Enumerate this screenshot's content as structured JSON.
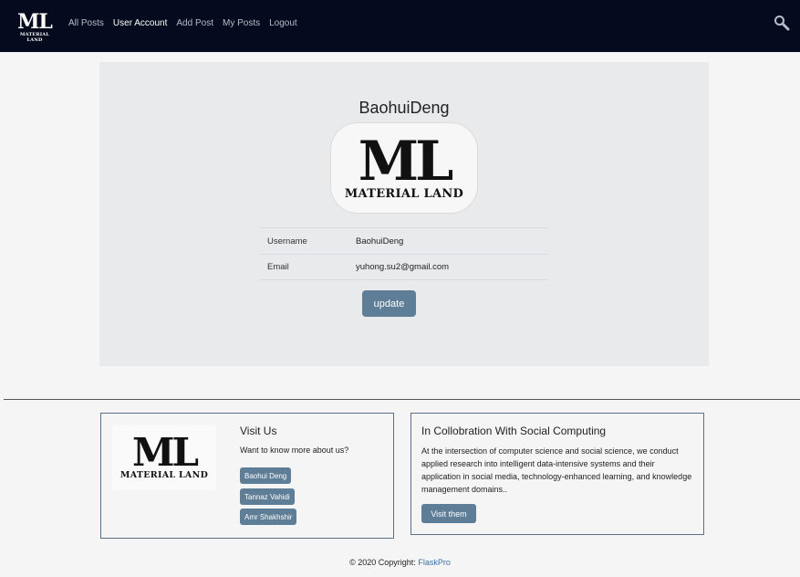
{
  "nav": {
    "brand_big": "ML",
    "brand_small": "MATERIAL LAND",
    "links": [
      "All Posts",
      "User Account",
      "Add Post",
      "My Posts",
      "Logout"
    ],
    "active": "User Account",
    "search_icon": "search-icon"
  },
  "profile": {
    "name": "BaohuiDeng",
    "avatar_big": "ML",
    "avatar_small": "MATERIAL LAND",
    "username_label": "Username",
    "username_value": "BaohuiDeng",
    "email_label": "Email",
    "email_value": "yuhong.su2@gmail.com",
    "update_label": "update"
  },
  "footer": {
    "logo_big": "ML",
    "logo_small": "MATERIAL LAND",
    "visit_title": "Visit Us",
    "visit_sub": "Want to know more about us?",
    "members": [
      "Baohui Deng",
      "Tannaz Vahidi",
      "Amr Shakhshir"
    ],
    "collab_title": "In Collobration With Social Computing",
    "collab_text": "At the intersection of computer science and social science, we conduct applied research into intelligent data-intensive systems and their application in social media, technology-enhanced learning, and knowledge management domains..",
    "visit_them_label": "Visit them",
    "copyright_prefix": "© 2020 Copyright:",
    "copyright_link": "FlaskPro"
  },
  "colors": {
    "navbar": "#050a1e",
    "accent_button": "#5e7d96",
    "link": "#3a6fa8"
  }
}
